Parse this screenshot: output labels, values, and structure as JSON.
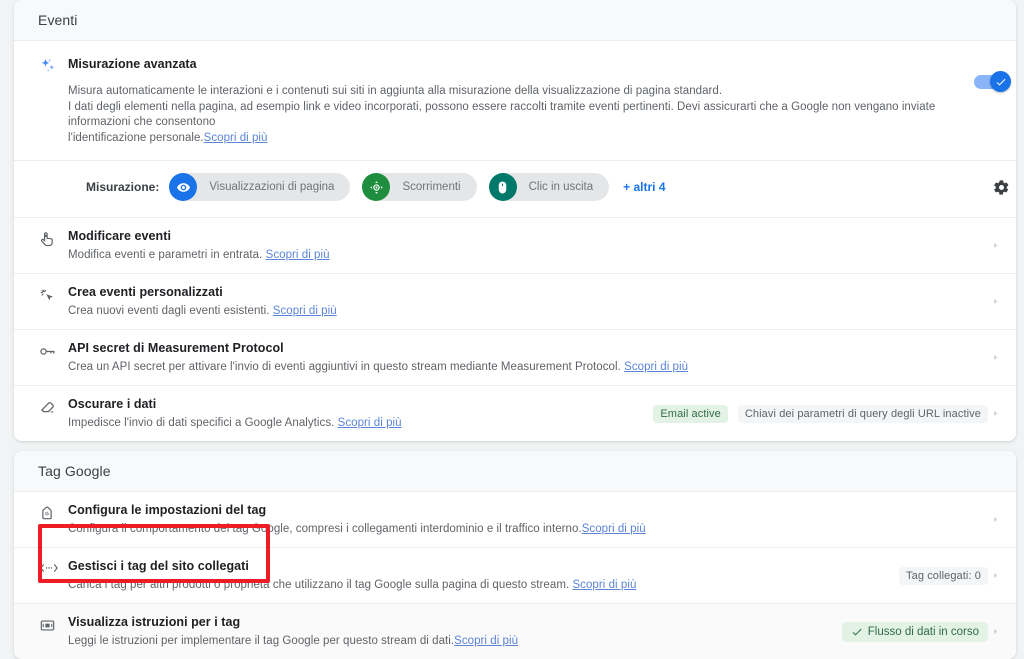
{
  "eventi_card": {
    "header": "Eventi",
    "advanced": {
      "icon": "sparkle-icon",
      "title": "Misurazione avanzata",
      "desc_line1": "Misura automaticamente le interazioni e i contenuti sui siti in aggiunta alla misurazione della visualizzazione di pagina standard.",
      "desc_line2": "I dati degli elementi nella pagina, ad esempio link e video incorporati, possono essere raccolti tramite eventi pertinenti. Devi assicurarti che a Google non vengano inviate informazioni che consentono",
      "desc_line3": "l'identificazione personale.",
      "learn_more": "Scopri di più",
      "toggle_on": true,
      "toggle_color": "#1a73e8",
      "measure_label": "Misurazione:",
      "chips": [
        {
          "label": "Visualizzazioni di pagina",
          "icon": "eye-icon",
          "color": "#1a73e8"
        },
        {
          "label": "Scorrimenti",
          "icon": "scroll-target-icon",
          "color": "#1e8e3e"
        },
        {
          "label": "Clic in uscita",
          "icon": "mouse-icon",
          "color": "#00796b"
        }
      ],
      "more_link": "+ altri 4",
      "settings_icon": "gear-icon"
    },
    "rows": [
      {
        "icon": "touch-hand-icon",
        "title": "Modificare eventi",
        "desc": "Modifica eventi e parametri in entrata.",
        "learn_more": "Scopri di più",
        "badges": []
      },
      {
        "icon": "magic-cursor-icon",
        "title": "Crea eventi personalizzati",
        "desc": "Crea nuovi eventi dagli eventi esistenti.",
        "learn_more": "Scopri di più",
        "badges": []
      },
      {
        "icon": "key-icon",
        "title": "API secret di Measurement Protocol",
        "desc": "Crea un API secret per attivare l'invio di eventi aggiuntivi in questo stream mediante Measurement Protocol.",
        "learn_more": "Scopri di più",
        "badges": []
      },
      {
        "icon": "eraser-icon",
        "title": "Oscurare i dati",
        "desc": "Impedisce l'invio di dati specifici a Google Analytics.",
        "learn_more": "Scopri di più",
        "badges": [
          {
            "text": "Email active",
            "style": "green"
          },
          {
            "text": "Chiavi dei parametri di query degli URL inactive",
            "style": "grey"
          }
        ]
      }
    ]
  },
  "tag_card": {
    "header": "Tag Google",
    "rows": [
      {
        "icon": "google-tag-icon",
        "title": "Configura le impostazioni del tag",
        "desc": "Configura il comportamento del tag Google, compresi i collegamenti interdominio e il traffico interno.",
        "learn_more": "Scopri di più",
        "right_text": ""
      },
      {
        "icon": "code-brackets-icon",
        "title": "Gestisci i tag del sito collegati",
        "desc": "Carica i tag per altri prodotti o proprietà che utilizzano il tag Google sulla pagina di questo stream.",
        "learn_more": "Scopri di più",
        "right_text": "Tag collegati: 0"
      },
      {
        "icon": "tag-instructions-icon",
        "title": "Visualizza istruzioni per i tag",
        "desc": "Leggi le istruzioni per implementare il tag Google per questo stream di dati.",
        "learn_more": "Scopri di più",
        "right_text": "Flusso di dati in corso",
        "right_badge_style": "check-green",
        "highlighted": true
      }
    ]
  },
  "annotation": {
    "type": "red-rectangle",
    "color": "#ee1c25",
    "target": "Visualizza istruzioni per i tag"
  }
}
